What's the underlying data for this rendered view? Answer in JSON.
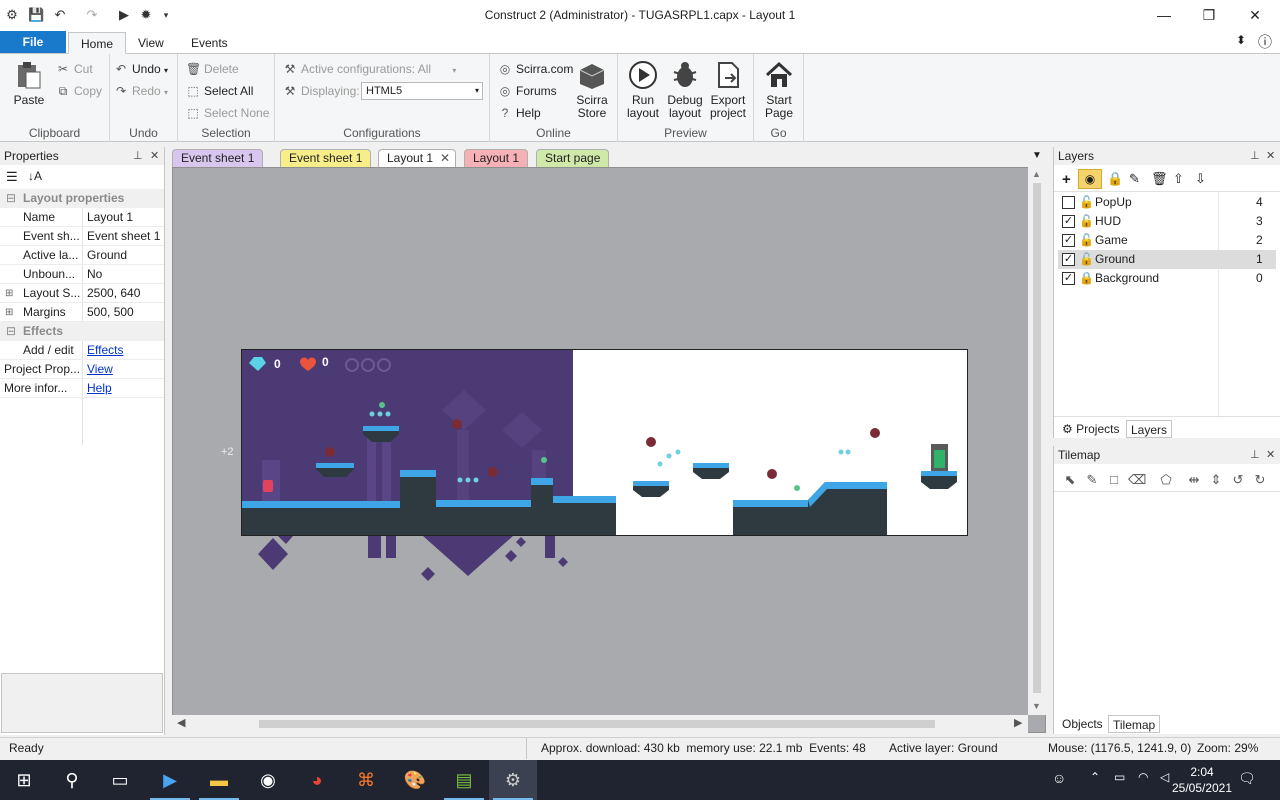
{
  "window": {
    "title": "Construct 2 (Administrator) - TUGASRPL1.capx - Layout 1"
  },
  "ribbon_tabs": [
    "File",
    "Home",
    "View",
    "Events"
  ],
  "ribbon": {
    "clipboard": {
      "paste": "Paste",
      "cut": "Cut",
      "copy": "Copy",
      "label": "Clipboard"
    },
    "undo": {
      "undo": "Undo",
      "redo": "Redo",
      "label": "Undo"
    },
    "selection": {
      "delete": "Delete",
      "select_all": "Select All",
      "select_none": "Select None",
      "label": "Selection"
    },
    "configurations": {
      "active": "Active configurations: All",
      "displaying_label": "Displaying:",
      "displaying_value": "HTML5",
      "label": "Configurations"
    },
    "online": {
      "scirra": "Scirra.com",
      "forums": "Forums",
      "help": "Help",
      "store_line1": "Scirra",
      "store_line2": "Store",
      "label": "Online"
    },
    "preview": {
      "run1": "Run",
      "run2": "layout",
      "debug1": "Debug",
      "debug2": "layout",
      "export1": "Export",
      "export2": "project",
      "label": "Preview"
    },
    "go": {
      "start1": "Start",
      "start2": "Page",
      "label": "Go"
    }
  },
  "properties": {
    "title": "Properties",
    "category_layout": "Layout properties",
    "rows": [
      {
        "k": "Name",
        "v": "Layout 1"
      },
      {
        "k": "Event sh...",
        "v": "Event sheet 1"
      },
      {
        "k": "Active la...",
        "v": "Ground"
      },
      {
        "k": "Unboun...",
        "v": "No"
      },
      {
        "k": "Layout S...",
        "v": "2500, 640"
      },
      {
        "k": "Margins",
        "v": "500, 500"
      }
    ],
    "category_effects": "Effects",
    "add_edit": "Add / edit",
    "effects_link": "Effects",
    "project_props": "Project Prop...",
    "project_link": "View",
    "more_info": "More infor...",
    "help_link": "Help"
  },
  "doc_tabs": [
    "Event sheet 1",
    "Event sheet 1",
    "Layout 1",
    "Layout 1",
    "Start page"
  ],
  "canvas": {
    "margin_label": "+2",
    "hud_gems": "0",
    "hud_hearts": "0"
  },
  "layers": {
    "title": "Layers",
    "items": [
      {
        "name": "PopUp",
        "index": "4",
        "checked": false
      },
      {
        "name": "HUD",
        "index": "3",
        "checked": true
      },
      {
        "name": "Game",
        "index": "2",
        "checked": true
      },
      {
        "name": "Ground",
        "index": "1",
        "checked": true
      },
      {
        "name": "Background",
        "index": "0",
        "checked": true
      }
    ],
    "tab_projects": "Projects",
    "tab_layers": "Layers"
  },
  "tilemap": {
    "title": "Tilemap",
    "tab_objects": "Objects",
    "tab_tilemap": "Tilemap"
  },
  "status": {
    "ready": "Ready",
    "download": "Approx. download: 430 kb  memory use: 22.1 mb  Events: 48",
    "active_layer": "Active layer: Ground",
    "mouse": "Mouse: (1176.5, 1241.9, 0)",
    "zoom": "Zoom: 29%"
  },
  "taskbar": {
    "time": "2:04",
    "date": "25/05/2021"
  },
  "colors": {
    "file_tab": "#1979ca",
    "level_purple": "#4b3a73",
    "ground_dark": "#2f3a40",
    "ground_blue": "#3ea6e6",
    "canvas_grey": "#a9aaad"
  }
}
